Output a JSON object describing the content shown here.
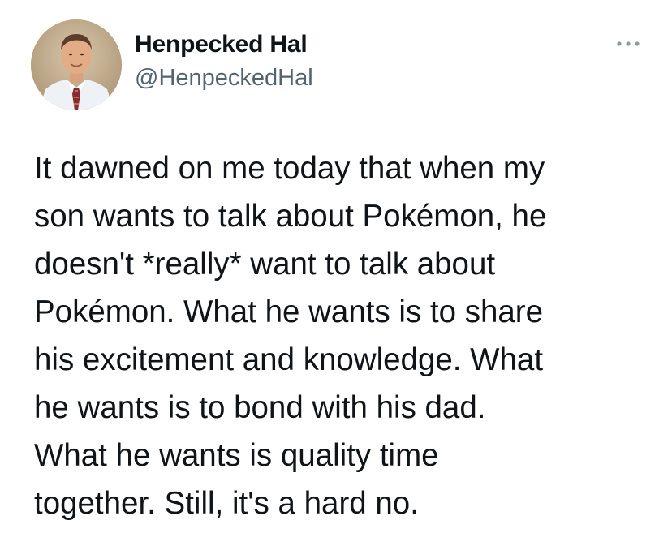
{
  "author": {
    "display_name": "Henpecked Hal",
    "handle": "@HenpeckedHal",
    "avatar_icon": "profile-photo"
  },
  "more_icon": "ellipsis-icon",
  "tweet": {
    "lines": [
      "It dawned on me today that when my",
      "son wants to talk about Pokémon, he",
      "doesn't *really* want to talk about",
      "Pokémon. What he wants is to share",
      "his excitement and knowledge. What",
      "he wants is to bond with his dad.",
      "What he wants is quality time",
      "together. Still, it's a hard no."
    ]
  },
  "colors": {
    "text_primary": "#0f1419",
    "text_secondary": "#536471",
    "background": "#ffffff"
  }
}
